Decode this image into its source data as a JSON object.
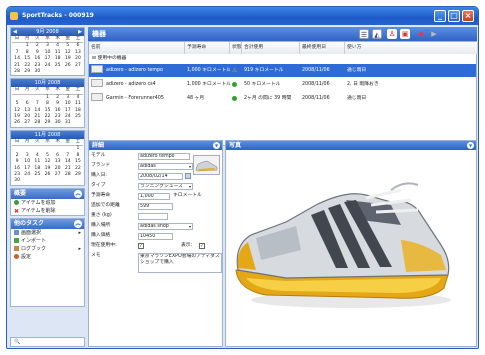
{
  "window": {
    "title": "SportTracks - 000919",
    "btn_min": "_",
    "btn_max": "□",
    "btn_close": "×"
  },
  "calendars": [
    {
      "title": "9月 2008",
      "prev": "◀",
      "next": "▶",
      "dow": [
        "日",
        "月",
        "火",
        "水",
        "木",
        "金",
        "土"
      ],
      "weeks": [
        [
          "",
          "1",
          "2",
          "3",
          "4",
          "5",
          "6"
        ],
        [
          "7",
          "8",
          "9",
          "10",
          "11",
          "12",
          "13"
        ],
        [
          "14",
          "15",
          "16",
          "17",
          "18",
          "19",
          "20"
        ],
        [
          "21",
          "22",
          "23",
          "24",
          "25",
          "26",
          "27"
        ],
        [
          "28",
          "29",
          "30",
          "",
          "",
          "",
          ""
        ]
      ]
    },
    {
      "title": "10月 2008",
      "dow": [
        "日",
        "月",
        "火",
        "水",
        "木",
        "金",
        "土"
      ],
      "weeks": [
        [
          "",
          "",
          "",
          "1",
          "2",
          "3",
          "4"
        ],
        [
          "5",
          "6",
          "7",
          "8",
          "9",
          "10",
          "11"
        ],
        [
          "12",
          "13",
          "14",
          "15",
          "16",
          "17",
          "18"
        ],
        [
          "19",
          "20",
          "21",
          "22",
          "23",
          "24",
          "25"
        ],
        [
          "26",
          "27",
          "28",
          "29",
          "30",
          "31",
          ""
        ]
      ]
    },
    {
      "title": "11月 2008",
      "dow": [
        "日",
        "月",
        "火",
        "水",
        "木",
        "金",
        "土"
      ],
      "weeks": [
        [
          "",
          "",
          "",
          "",
          "",
          "",
          "1"
        ],
        [
          "2",
          "3",
          "4",
          "5",
          "6",
          "7",
          "8"
        ],
        [
          "9",
          "10",
          "11",
          "12",
          "13",
          "14",
          "15"
        ],
        [
          "16",
          "17",
          "18",
          "19",
          "20",
          "21",
          "22"
        ],
        [
          "23",
          "24",
          "25",
          "26",
          "27",
          "28",
          "29"
        ],
        [
          "30",
          "",
          "",
          "",
          "",
          "",
          ""
        ]
      ]
    }
  ],
  "tasks": {
    "title": "概要",
    "items": [
      "アイテムを追加",
      "アイテムを削除"
    ]
  },
  "other": {
    "title": "他のタスク",
    "items": [
      "画面選択",
      "インポート",
      "ログブック",
      "設定"
    ]
  },
  "search": {
    "icon": "🔍"
  },
  "equipment": {
    "title": "機器",
    "columns": [
      "名前",
      "予測寿命",
      "状態",
      "合計使用",
      "最終使用日",
      "使い方"
    ],
    "group": "使用中の機器",
    "rows": [
      {
        "name": "adizero - adizero tempo",
        "life": "1,000 キロメートル",
        "status": "warn",
        "total": "919 キロメートル",
        "last": "2008/11/06",
        "usage": "通じ雨日",
        "selected": true
      },
      {
        "name": "adizero - adizero cs4",
        "life": "1,000 キロメートル",
        "status": "ok",
        "total": "50 キロメートル",
        "last": "2008/11/06",
        "usage": "2, 日 雨降おき",
        "selected": false
      },
      {
        "name": "Garmin - Forerunner405",
        "life": "48 ヶ月",
        "status": "ok",
        "total": "2ヶ月 の間に 39 時間",
        "last": "2008/11/06",
        "usage": "通じ雨日",
        "selected": false
      }
    ]
  },
  "details": {
    "title": "詳細",
    "fields": [
      {
        "label": "モデル",
        "value": "adizero tempo"
      },
      {
        "label": "ブランド",
        "value": "adidas"
      },
      {
        "label": "購入日:",
        "value": "2008/02/14"
      },
      {
        "label": "タイプ",
        "value": "ランニングシューズ"
      },
      {
        "label": "予測寿命",
        "value": "1,000",
        "unit": "キロメートル"
      },
      {
        "label": "追加での距離",
        "value": "599"
      },
      {
        "label": "重さ (kg)",
        "value": ""
      },
      {
        "label": "購入場所",
        "value": "adidas shop"
      },
      {
        "label": "購入価格",
        "value": "10450"
      },
      {
        "label": "現在使用中:",
        "value": ""
      },
      {
        "label": "メモ",
        "value": "東京マラソンEXPO会場のアディダスショップで購入"
      }
    ],
    "show_label": "表示:"
  },
  "photo": {
    "title": "写真"
  },
  "colors": {
    "accent": "#2f63c6",
    "selected_row": "#2f6bd6"
  }
}
